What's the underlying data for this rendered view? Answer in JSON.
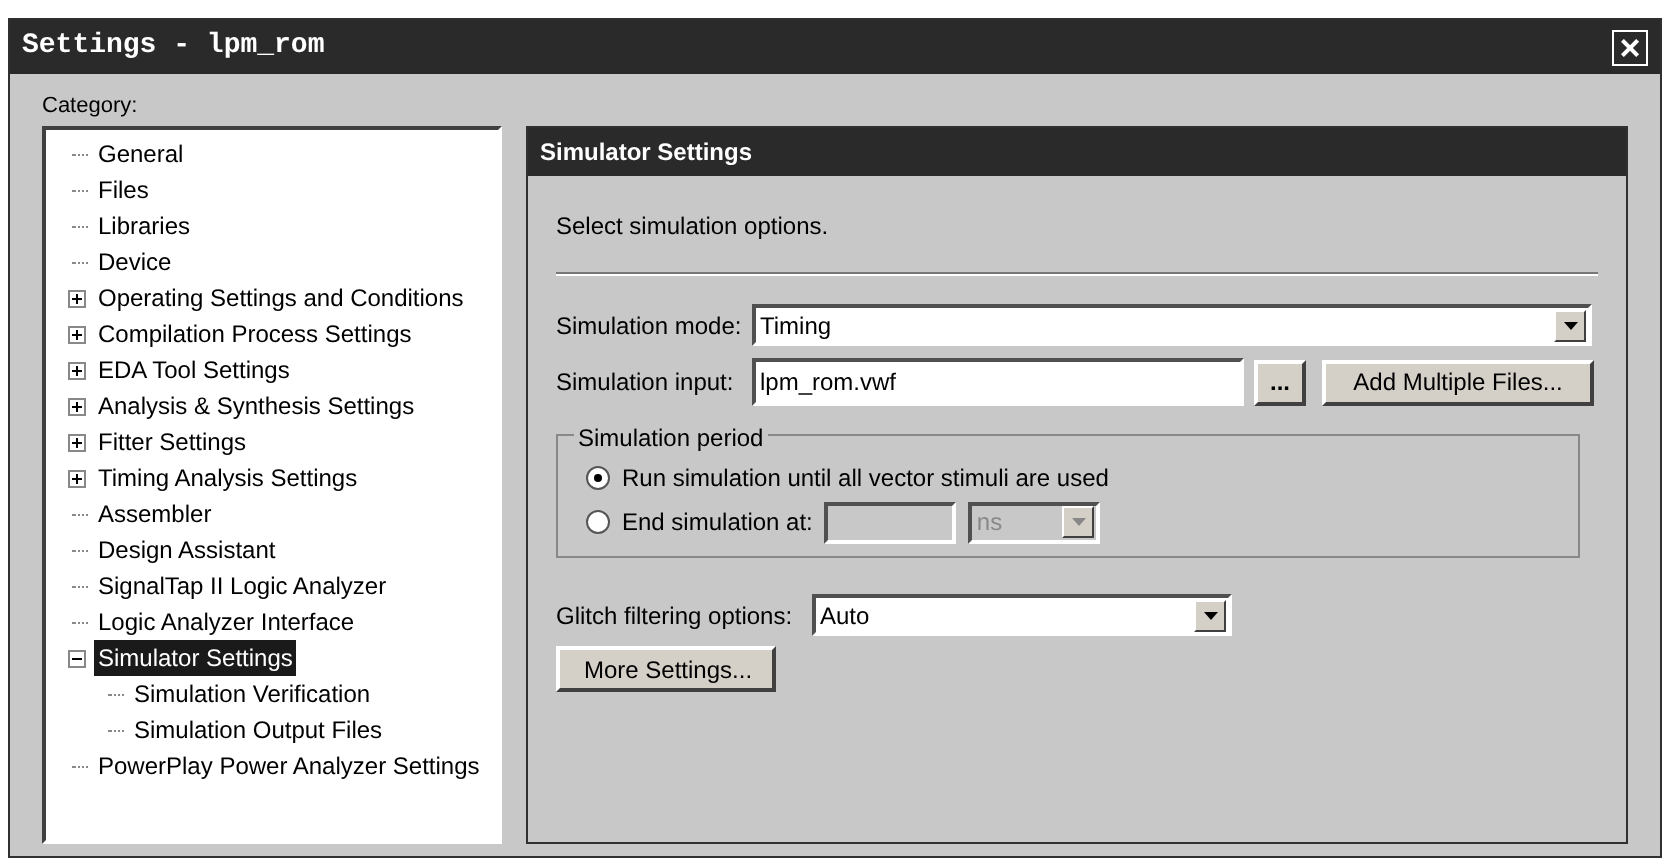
{
  "window": {
    "title": "Settings - lpm_rom",
    "close": "×"
  },
  "category": {
    "label": "Category:",
    "items": [
      {
        "label": "General",
        "kind": "leaf",
        "selected": false
      },
      {
        "label": "Files",
        "kind": "leaf",
        "selected": false
      },
      {
        "label": "Libraries",
        "kind": "leaf",
        "selected": false
      },
      {
        "label": "Device",
        "kind": "leaf",
        "selected": false
      },
      {
        "label": "Operating Settings and Conditions",
        "kind": "group",
        "expanded": false,
        "selected": false
      },
      {
        "label": "Compilation Process Settings",
        "kind": "group",
        "expanded": false,
        "selected": false
      },
      {
        "label": "EDA Tool Settings",
        "kind": "group",
        "expanded": false,
        "selected": false
      },
      {
        "label": "Analysis & Synthesis Settings",
        "kind": "group",
        "expanded": false,
        "selected": false
      },
      {
        "label": "Fitter Settings",
        "kind": "group",
        "expanded": false,
        "selected": false
      },
      {
        "label": "Timing Analysis Settings",
        "kind": "group",
        "expanded": false,
        "selected": false
      },
      {
        "label": "Assembler",
        "kind": "leaf",
        "selected": false
      },
      {
        "label": "Design Assistant",
        "kind": "leaf",
        "selected": false
      },
      {
        "label": "SignalTap II Logic Analyzer",
        "kind": "leaf",
        "selected": false
      },
      {
        "label": "Logic Analyzer Interface",
        "kind": "leaf",
        "selected": false
      },
      {
        "label": "Simulator Settings",
        "kind": "group",
        "expanded": true,
        "selected": true,
        "children": [
          {
            "label": "Simulation Verification",
            "kind": "leaf",
            "selected": false
          },
          {
            "label": "Simulation Output Files",
            "kind": "leaf",
            "selected": false
          }
        ]
      },
      {
        "label": "PowerPlay Power Analyzer Settings",
        "kind": "leaf",
        "selected": false
      }
    ]
  },
  "panel": {
    "title": "Simulator Settings",
    "description": "Select simulation options.",
    "simulation_mode": {
      "label": "Simulation mode:",
      "value": "Timing"
    },
    "simulation_input": {
      "label": "Simulation input:",
      "value": "lpm_rom.vwf",
      "browse": "...",
      "add_button": "Add Multiple Files..."
    },
    "simulation_period": {
      "label": "Simulation period",
      "options": [
        {
          "label": "Run simulation until all vector stimuli are used",
          "selected": true
        },
        {
          "label": "End simulation at:",
          "selected": false,
          "unit": "ns",
          "disabled": true
        }
      ]
    },
    "glitch_filtering": {
      "label": "Glitch filtering options:",
      "value": "Auto"
    },
    "more_button": "More Settings..."
  }
}
